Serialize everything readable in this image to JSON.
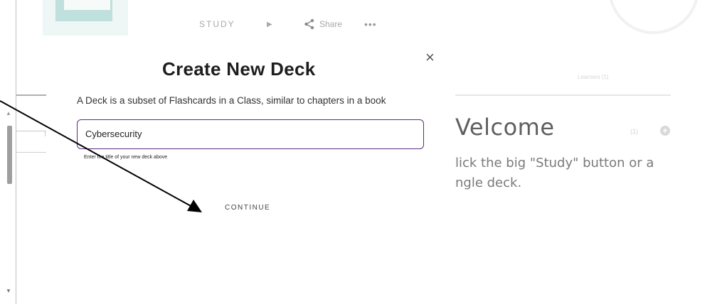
{
  "toolbar": {
    "study_label": "STUDY",
    "play_icon": "play-icon",
    "share_icon": "share-icon",
    "share_label": "Share",
    "more_icon": "more-icon",
    "more_glyph": "•••"
  },
  "modal": {
    "title": "Create New Deck",
    "close_icon": "close-icon",
    "close_glyph": "×",
    "subtitle": "A Deck is a subset of Flashcards in a Class, similar to chapters in a book",
    "input_value": "Cybersecurity",
    "helper_text": "Enter the title of your new deck above",
    "continue_label": "CONTINUE",
    "accent_color": "#5c2d7e"
  },
  "background": {
    "learners_label": "Learners (1)",
    "welcome_title": "Velcome",
    "count_label": "(1)",
    "plus_glyph": "+",
    "line1": "lick the big \"Study\" button or a",
    "line2": "ngle deck."
  },
  "scrollbar": {
    "up_glyph": "▲",
    "down_glyph": "▼"
  }
}
